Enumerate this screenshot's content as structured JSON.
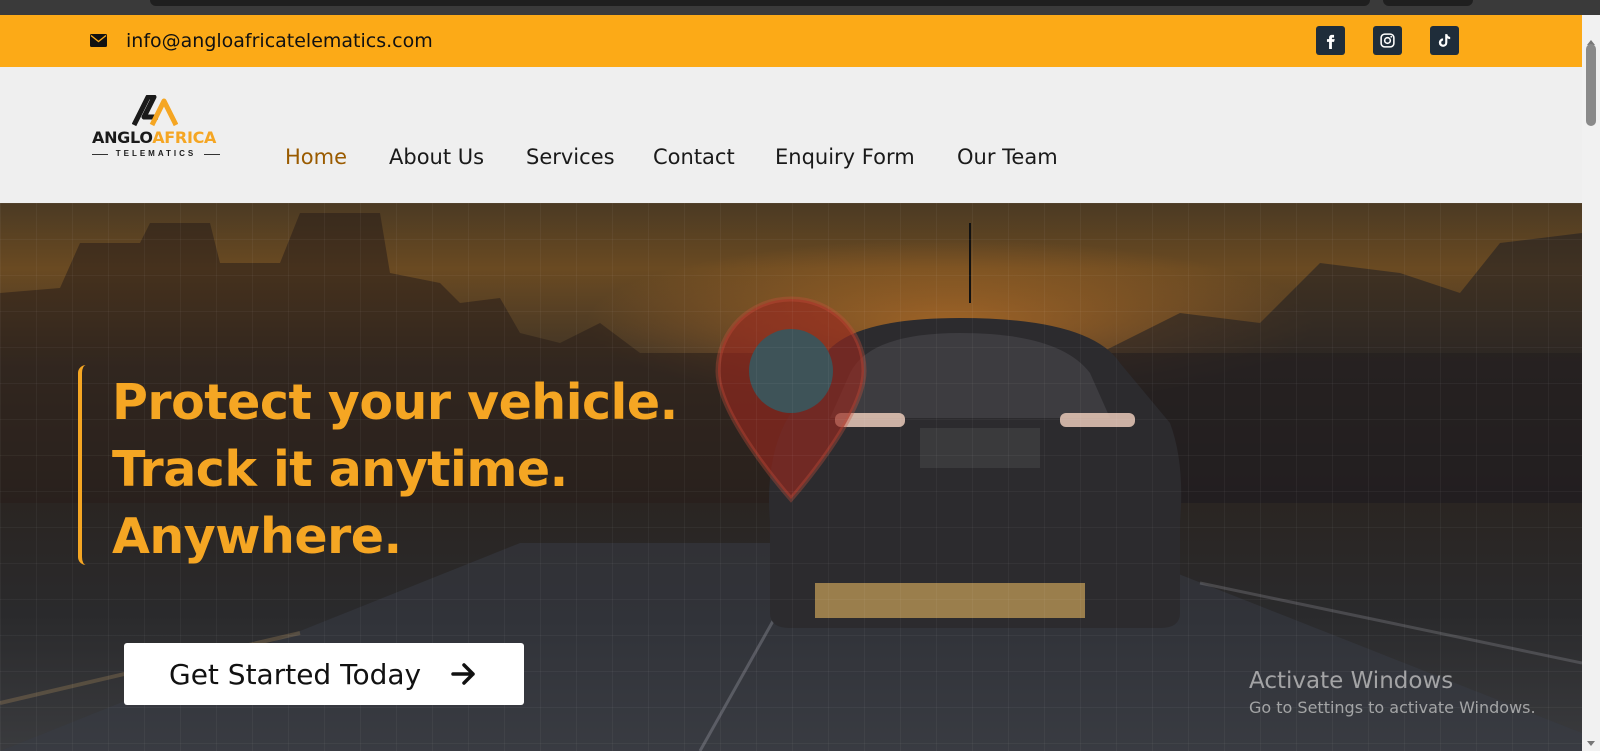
{
  "topbar": {
    "email": "info@angloafricatelematics.com",
    "bg_color": "#fcaa17",
    "icons": [
      "envelope-icon",
      "facebook-icon",
      "instagram-icon",
      "tiktok-icon"
    ]
  },
  "logo": {
    "brand_part1": "ANGLO",
    "brand_part2": "AFRICA",
    "subtitle": "TELEMATICS"
  },
  "nav": {
    "items": [
      {
        "label": "Home",
        "active": true
      },
      {
        "label": "About Us"
      },
      {
        "label": "Services"
      },
      {
        "label": "Contact"
      },
      {
        "label": "Enquiry Form"
      },
      {
        "label": "Our Team"
      }
    ]
  },
  "hero": {
    "headline_lines": [
      "Protect your vehicle.",
      "Track it anytime.",
      "Anywhere."
    ],
    "cta_label": "Get Started Today",
    "accent_color": "#f5a623"
  },
  "watermark": {
    "title": "Activate Windows",
    "subtitle": "Go to Settings to activate Windows."
  }
}
